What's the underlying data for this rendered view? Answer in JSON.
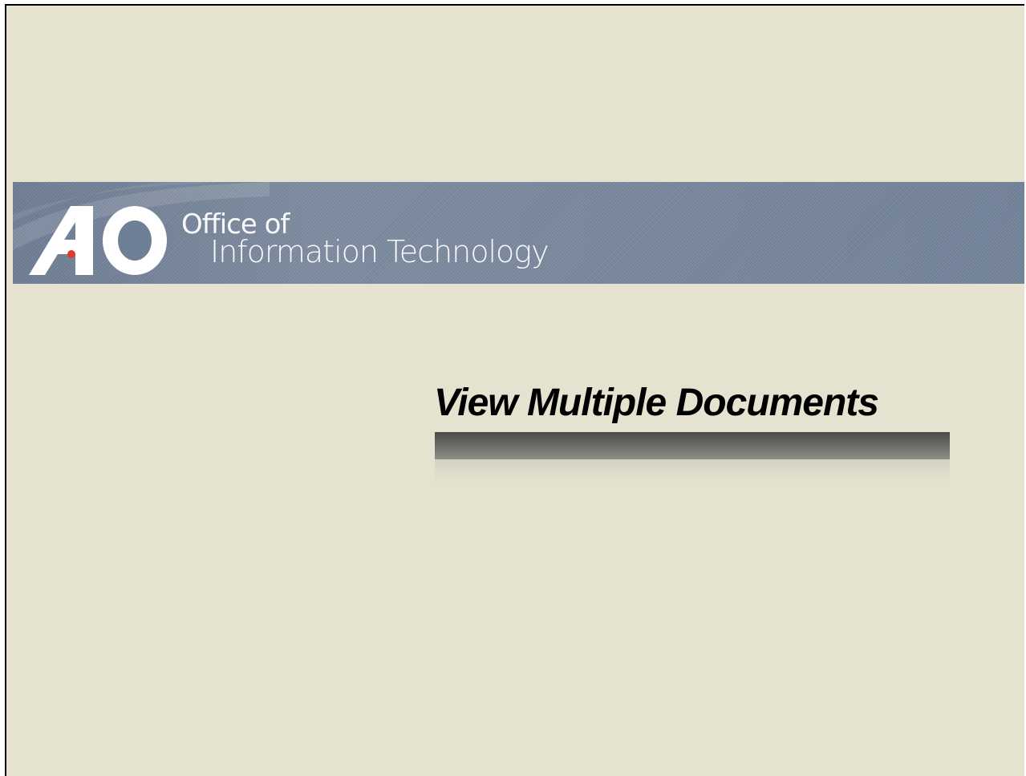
{
  "banner": {
    "logo_letters": "AO",
    "org_line1": "Office of",
    "org_line2": "Information  Technology"
  },
  "slide": {
    "title": "View Multiple Documents"
  },
  "colors": {
    "background": "#e5e2d0",
    "banner": "#6f7f96",
    "logo_accent": "#e23b2e",
    "title_text": "#000000"
  }
}
